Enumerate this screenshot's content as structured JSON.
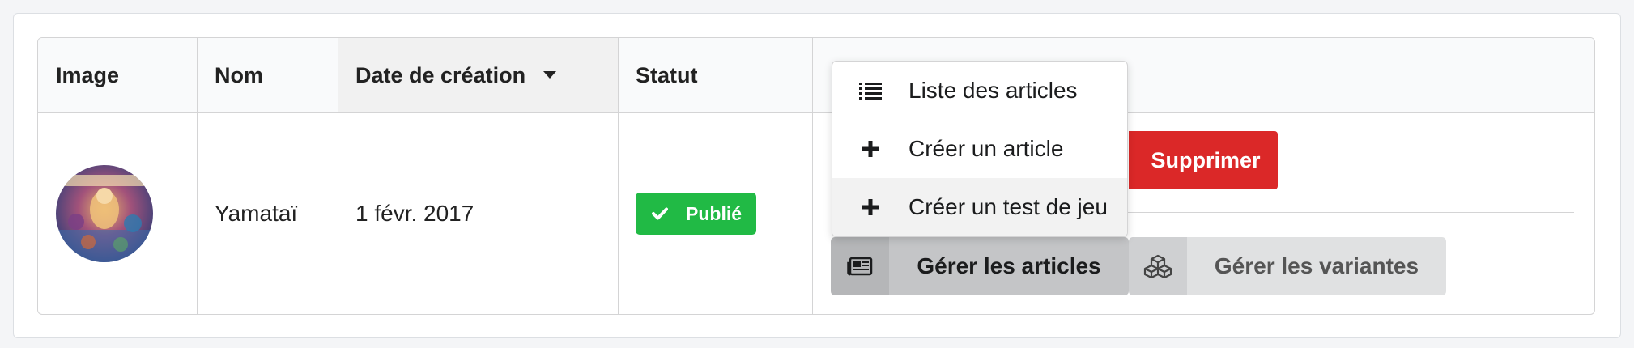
{
  "table": {
    "headers": {
      "image": "Image",
      "name": "Nom",
      "created": "Date de création",
      "status": "Statut"
    },
    "sort_icon": "caret-down-icon",
    "rows": [
      {
        "image_alt": "Yamataï cover",
        "name": "Yamataï",
        "created": "1 févr. 2017",
        "status": "Publié",
        "status_icon": "check-icon",
        "status_color": "#21ba45"
      }
    ]
  },
  "actions": {
    "delete_label": "Supprimer",
    "delete_color": "#db2828",
    "manage_articles_label": "Gérer les articles",
    "manage_articles_icon": "newspaper-icon",
    "manage_variants_label": "Gérer les variantes",
    "manage_variants_icon": "cubes-icon"
  },
  "dropdown": {
    "items": [
      {
        "label": "Liste des articles",
        "icon": "list-icon"
      },
      {
        "label": "Créer un article",
        "icon": "plus-icon"
      },
      {
        "label": "Créer un test de jeu",
        "icon": "plus-icon"
      }
    ]
  }
}
